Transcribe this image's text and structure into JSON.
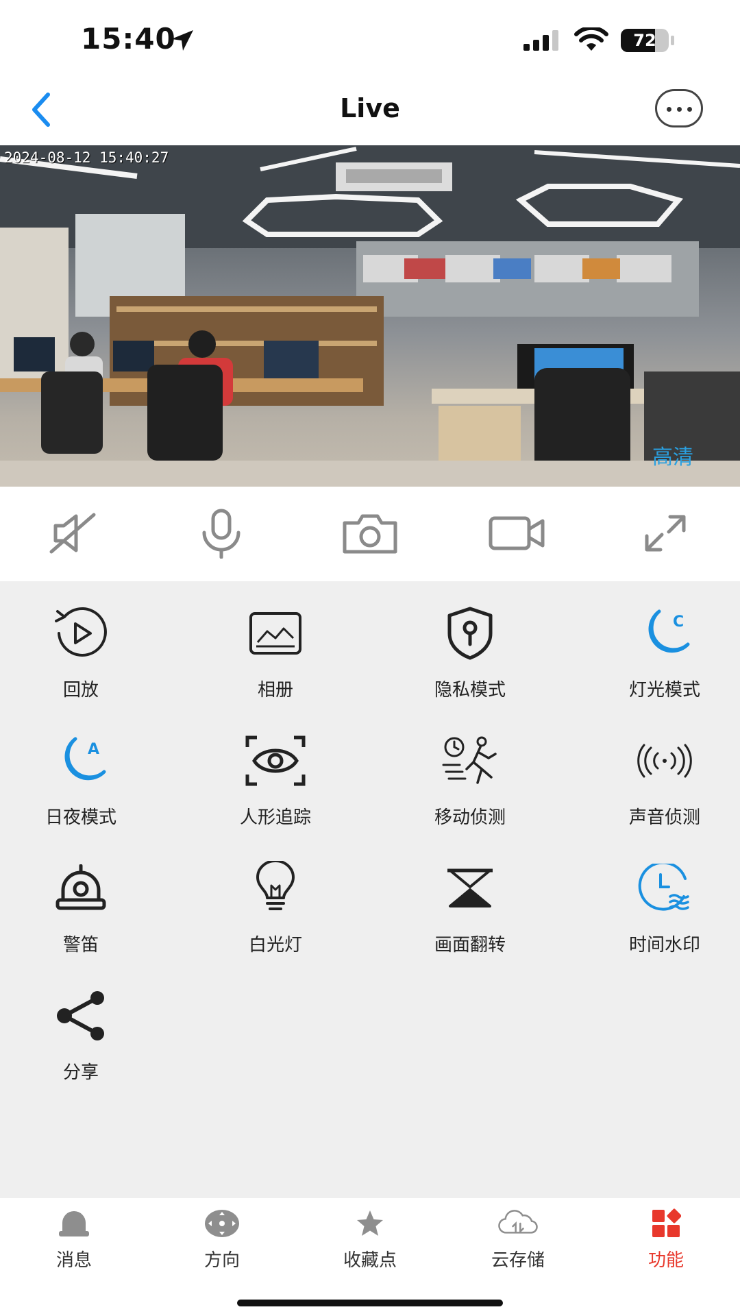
{
  "status_bar": {
    "time": "15:40",
    "battery_level": "72",
    "battery_fraction": 0.72
  },
  "nav": {
    "title": "Live",
    "back_icon": "chevron-left-icon",
    "more_icon": "more-horizontal-icon"
  },
  "video": {
    "timestamp": "2024-08-12 15:40:27",
    "quality_label": "高清"
  },
  "controls": [
    {
      "name": "speaker-muted-icon"
    },
    {
      "name": "microphone-icon"
    },
    {
      "name": "camera-icon"
    },
    {
      "name": "video-record-icon"
    },
    {
      "name": "fullscreen-icon"
    }
  ],
  "features": [
    {
      "label": "回放",
      "icon": "playback-icon"
    },
    {
      "label": "相册",
      "icon": "album-icon"
    },
    {
      "label": "隐私模式",
      "icon": "privacy-shield-icon"
    },
    {
      "label": "灯光模式",
      "icon": "light-mode-moon-icon"
    },
    {
      "label": "日夜模式",
      "icon": "day-night-moon-icon"
    },
    {
      "label": "人形追踪",
      "icon": "human-tracking-icon"
    },
    {
      "label": "移动侦测",
      "icon": "motion-detection-icon"
    },
    {
      "label": "声音侦测",
      "icon": "sound-detection-icon"
    },
    {
      "label": "警笛",
      "icon": "siren-icon"
    },
    {
      "label": "白光灯",
      "icon": "lightbulb-icon"
    },
    {
      "label": "画面翻转",
      "icon": "flip-icon"
    },
    {
      "label": "时间水印",
      "icon": "time-watermark-icon"
    },
    {
      "label": "分享",
      "icon": "share-icon"
    }
  ],
  "tabs": [
    {
      "label": "消息",
      "icon": "bell-icon"
    },
    {
      "label": "方向",
      "icon": "direction-pad-icon"
    },
    {
      "label": "收藏点",
      "icon": "star-icon"
    },
    {
      "label": "云存储",
      "icon": "cloud-storage-icon"
    },
    {
      "label": "功能",
      "icon": "function-grid-icon",
      "active": true
    }
  ],
  "colors": {
    "accent_blue": "#1a90e0",
    "active_tab": "#e8382c",
    "grid_background": "#efefef"
  }
}
